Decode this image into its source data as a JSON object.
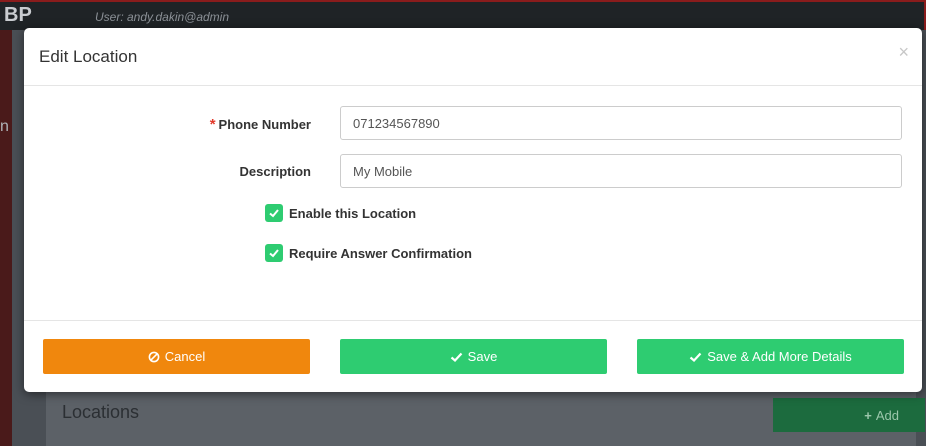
{
  "app": {
    "brand": "BP",
    "user": "User: andy.dakin@admin",
    "left_glyph": "n",
    "section_title": "Locations",
    "add_button": "Add"
  },
  "modal": {
    "title": "Edit Location",
    "close_symbol": "×",
    "fields": {
      "phone_label": "Phone Number",
      "phone_value": "071234567890",
      "description_label": "Description",
      "description_value": "My Mobile"
    },
    "checkboxes": {
      "enable_label": "Enable this Location",
      "enable_checked": true,
      "require_label": "Require Answer Confirmation",
      "require_checked": true
    },
    "buttons": {
      "cancel": "Cancel",
      "save": "Save",
      "save_more": "Save & Add More Details"
    }
  },
  "colors": {
    "accent_green": "#2ecc71",
    "cancel_orange": "#f0870d"
  }
}
